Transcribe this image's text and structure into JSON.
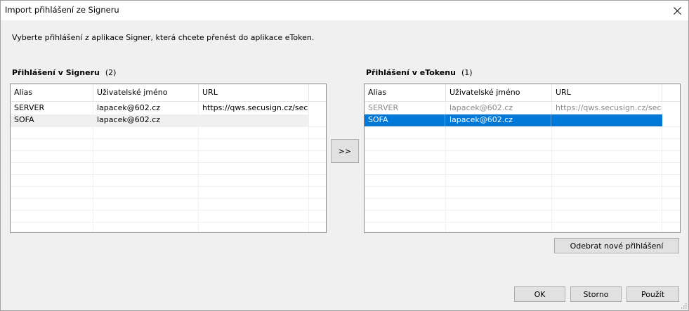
{
  "window": {
    "title": "Import přihlášení ze Signeru",
    "close_icon": "close-icon"
  },
  "instruction": "Vyberte přihlášení z aplikace Signer, která chcete přenést do aplikace eToken.",
  "left_group": {
    "title": "Přihlášení v Signeru",
    "count": "(2)",
    "columns": [
      "Alias",
      "Uživatelské jméno",
      "URL"
    ],
    "rows": [
      {
        "alias": "SERVER",
        "user": "lapacek@602.cz",
        "url": "https://qws.secusign.cz/sec..."
      },
      {
        "alias": "SOFA",
        "user": "lapacek@602.cz",
        "url": ""
      }
    ]
  },
  "right_group": {
    "title": "Přihlášení v eTokenu",
    "count": "(1)",
    "columns": [
      "Alias",
      "Uživatelské jméno",
      "URL"
    ],
    "rows": [
      {
        "alias": "SERVER",
        "user": "lapacek@602.cz",
        "url": "https://qws.secusign.cz/sec..."
      },
      {
        "alias": "SOFA",
        "user": "lapacek@602.cz",
        "url": ""
      }
    ]
  },
  "buttons": {
    "move": ">>",
    "remove": "Odebrat nové přihlášení",
    "ok": "OK",
    "cancel": "Storno",
    "apply": "Použít"
  },
  "colors": {
    "selection": "#0078d7",
    "disabled_text": "#8a8a8a",
    "window_bg": "#f0f0f0"
  }
}
